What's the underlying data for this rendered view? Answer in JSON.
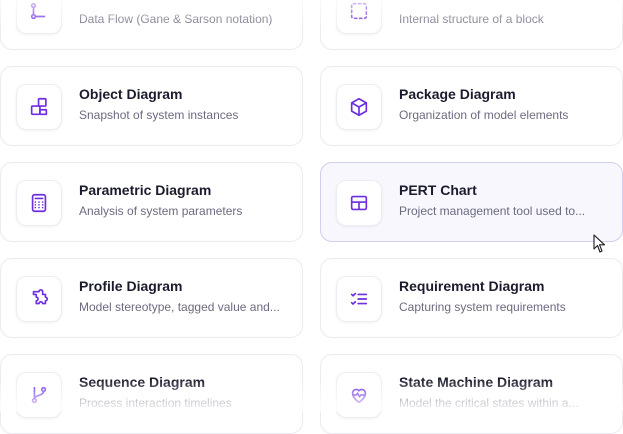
{
  "accent_color": "#6d2ee0",
  "cards": [
    {
      "title": "",
      "description": "Data Flow (Gane & Sarson notation)",
      "icon": "data-flow-icon"
    },
    {
      "title": "",
      "description": "Internal structure of a block",
      "icon": "internal-block-icon"
    },
    {
      "title": "Object Diagram",
      "description": "Snapshot of system instances",
      "icon": "shapes-icon"
    },
    {
      "title": "Package Diagram",
      "description": "Organization of model elements",
      "icon": "package-icon"
    },
    {
      "title": "Parametric Diagram",
      "description": "Analysis of system parameters",
      "icon": "calculator-icon"
    },
    {
      "title": "PERT Chart",
      "description": "Project management tool used to...",
      "icon": "layout-panel-icon"
    },
    {
      "title": "Profile Diagram",
      "description": "Model stereotype, tagged value and...",
      "icon": "puzzle-icon"
    },
    {
      "title": "Requirement Diagram",
      "description": "Capturing system requirements",
      "icon": "checklist-icon"
    },
    {
      "title": "Sequence Diagram",
      "description": "Process interaction timelines",
      "icon": "git-branch-icon"
    },
    {
      "title": "State Machine Diagram",
      "description": "Model the critical states within a...",
      "icon": "heart-pulse-icon"
    }
  ]
}
